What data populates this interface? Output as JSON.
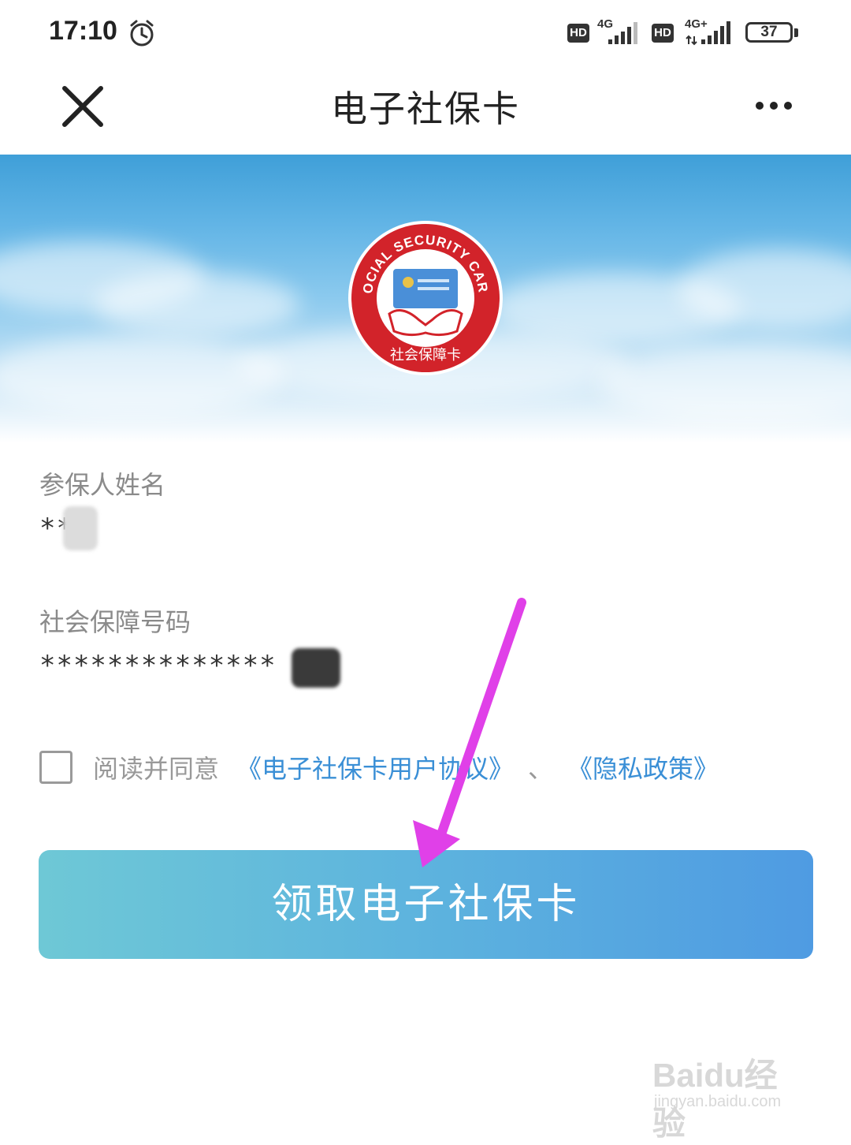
{
  "status_bar": {
    "time": "17:10",
    "hd1": "HD",
    "net1": "4G",
    "hd2": "HD",
    "net2": "4G+",
    "battery": "37"
  },
  "nav": {
    "title": "电子社保卡"
  },
  "logo": {
    "arc_text": "SOCIAL SECURITY CARD",
    "bottom_text": "社会保障卡"
  },
  "form": {
    "name_label": "参保人姓名",
    "name_value": "**",
    "id_label": "社会保障号码",
    "id_value": "**************"
  },
  "agreement": {
    "prefix": "阅读并同意",
    "link1": "《电子社保卡用户协议》",
    "separator": "、",
    "link2": "《隐私政策》"
  },
  "button": {
    "label": "领取电子社保卡"
  },
  "watermark": {
    "brand": "Baidu经验",
    "url": "jingyan.baidu.com"
  },
  "colors": {
    "accent_link": "#3a8fd6",
    "button_start": "#6ec8d6",
    "button_end": "#4f9be2",
    "arrow": "#e040e8"
  }
}
